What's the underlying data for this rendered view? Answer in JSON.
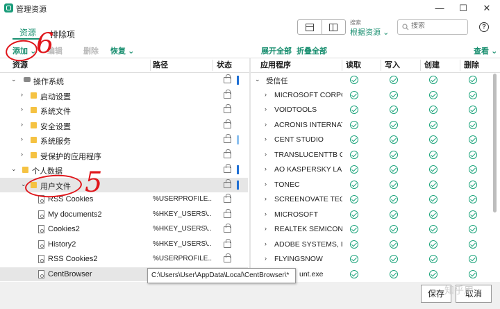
{
  "window": {
    "title": "管理资源",
    "minimize": "—",
    "maximize": "☐",
    "close": "✕"
  },
  "tabs": [
    {
      "label": "资源"
    },
    {
      "label": "排除项"
    }
  ],
  "search": {
    "caption": "搜索",
    "scope": "根据资源",
    "placeholder": "搜索"
  },
  "toolbar": {
    "add": "添加",
    "edit": "编辑",
    "delete": "删除",
    "restore": "恢复",
    "expand_all": "展开全部",
    "collapse_all": "折叠全部",
    "view": "查看"
  },
  "left_headers": {
    "resource": "资源",
    "path": "路径",
    "status": "状态"
  },
  "right_headers": {
    "app": "应用程序",
    "read": "读取",
    "write": "写入",
    "create": "创建",
    "delete": "删除"
  },
  "left_rows": [
    {
      "label": "操作系统",
      "path": ""
    },
    {
      "label": "启动设置",
      "path": ""
    },
    {
      "label": "系统文件",
      "path": ""
    },
    {
      "label": "安全设置",
      "path": ""
    },
    {
      "label": "系统服务",
      "path": ""
    },
    {
      "label": "受保护的应用程序",
      "path": ""
    },
    {
      "label": "个人数据",
      "path": ""
    },
    {
      "label": "用户文件",
      "path": ""
    },
    {
      "label": "RSS Cookies",
      "path": "%USERPROFILE..."
    },
    {
      "label": "My documents2",
      "path": "%HKEY_USERS\\..."
    },
    {
      "label": "Cookies2",
      "path": "%HKEY_USERS\\..."
    },
    {
      "label": "History2",
      "path": "%HKEY_USERS\\..."
    },
    {
      "label": "RSS Cookies2",
      "path": "%USERPROFILE..."
    },
    {
      "label": "CentBrowser",
      "path": ""
    }
  ],
  "right_rows": [
    {
      "label": "受信任"
    },
    {
      "label": "MICROSOFT CORPO..."
    },
    {
      "label": "VOIDTOOLS"
    },
    {
      "label": "ACRONIS INTERNAT..."
    },
    {
      "label": "CENT STUDIO"
    },
    {
      "label": "TRANSLUCENTTB O..."
    },
    {
      "label": "AO KASPERSKY LAB"
    },
    {
      "label": "TONEC"
    },
    {
      "label": "SCREENOVATE TEC..."
    },
    {
      "label": "MICROSOFT"
    },
    {
      "label": "REALTEK SEMICON..."
    },
    {
      "label": "ADOBE SYSTEMS, I..."
    },
    {
      "label": "FLYINGSNOW"
    },
    {
      "label": "unt.exe"
    }
  ],
  "tooltip": "C:\\Users\\User\\AppData\\Local\\CentBrowser\\*",
  "buttons": {
    "save": "保存",
    "cancel": "取消"
  },
  "annotations": {
    "six": "6",
    "five": "5"
  },
  "watermark": "知乎用",
  "colors": {
    "accent": "#1a8f70",
    "check": "#1aa37a",
    "status_bar": "#1e6fd4",
    "annotation": "#e0161b",
    "folder": "#f5c242"
  }
}
